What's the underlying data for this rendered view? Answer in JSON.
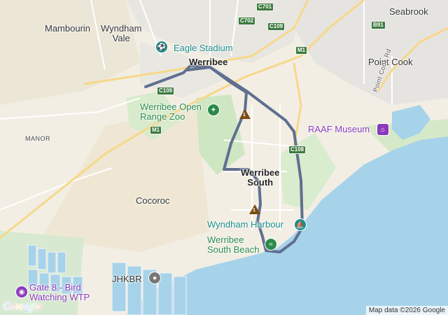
{
  "places": {
    "mambourin": "Mambourin",
    "wyndham_vale": "Wyndham\nVale",
    "werribee": "Werribee",
    "seabrook": "Seabrook",
    "point_cook": "Point Cook",
    "manor": "MANOR",
    "werribee_south": "Werribee\nSouth",
    "cocoroc": "Cocoroc",
    "jhkbr": "JHKBR",
    "point_cook_rd": "Point Cook Rd"
  },
  "pois": {
    "eagle_stadium": {
      "label": "Eagle Stadium",
      "icon": "stadium-icon",
      "color": "#1c8d8a"
    },
    "open_range_zoo": {
      "label": "Werribee Open\nRange Zoo",
      "icon": "paw-icon",
      "color": "#2a8a4a"
    },
    "raaf_museum": {
      "label": "RAAF Museum",
      "icon": "museum-icon",
      "color": "#8a3ab9"
    },
    "wyndham_harbour": {
      "label": "Wyndham Harbour",
      "icon": "boat-icon",
      "color": "#1c8d8a"
    },
    "south_beach": {
      "label": "Werribee\nSouth Beach",
      "icon": "beach-icon",
      "color": "#2a8a4a"
    },
    "gate8": {
      "label": "Gate 8 - Bird\nWatching WTP",
      "icon": "camera-icon",
      "color": "#8a3ab9"
    },
    "jhkbr_pin": {
      "icon": "place-pin-icon",
      "color": "#777777"
    }
  },
  "road_shields": {
    "c701": "C701",
    "c702": "C702",
    "c109_top": "C109",
    "b91": "B91",
    "m1_east": "M1",
    "c109_west": "C109",
    "m1_west": "M1",
    "c108": "C108"
  },
  "route_markers": {
    "marker1": "1",
    "marker2": "1"
  },
  "branding": {
    "logo": "Google",
    "attribution": "Map data ©2026 Google"
  },
  "colors": {
    "sea": "#a7d3ea",
    "land": "#f3efe6",
    "park": "#cfe6c3",
    "route": "#5f6f8f"
  }
}
